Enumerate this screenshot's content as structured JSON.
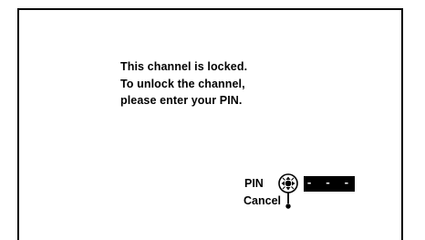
{
  "screen": {
    "message_lines": [
      "This channel is locked.",
      "To unlock the channel,",
      "please enter your PIN."
    ]
  },
  "controls": {
    "pin_label": "PIN",
    "cancel_label": "Cancel",
    "pin_value": "- - - -",
    "navigation_icon": "remote-navigation-pad-icon"
  }
}
